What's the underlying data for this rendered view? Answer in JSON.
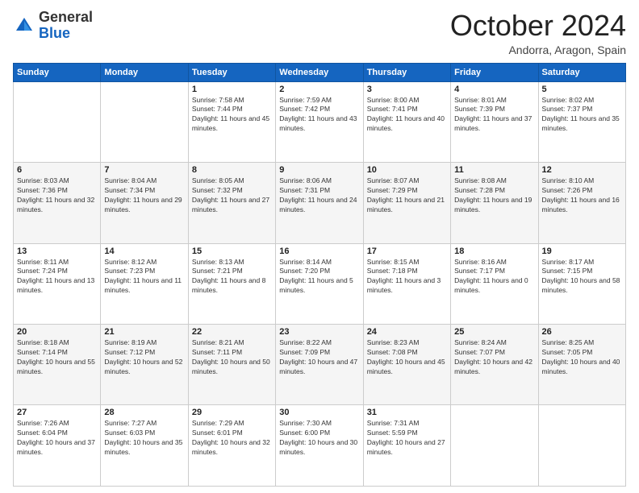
{
  "header": {
    "logo": {
      "general": "General",
      "blue": "Blue"
    },
    "title": "October 2024",
    "subtitle": "Andorra, Aragon, Spain"
  },
  "days_of_week": [
    "Sunday",
    "Monday",
    "Tuesday",
    "Wednesday",
    "Thursday",
    "Friday",
    "Saturday"
  ],
  "weeks": [
    [
      {
        "day": "",
        "info": ""
      },
      {
        "day": "",
        "info": ""
      },
      {
        "day": "1",
        "sunrise": "Sunrise: 7:58 AM",
        "sunset": "Sunset: 7:44 PM",
        "daylight": "Daylight: 11 hours and 45 minutes."
      },
      {
        "day": "2",
        "sunrise": "Sunrise: 7:59 AM",
        "sunset": "Sunset: 7:42 PM",
        "daylight": "Daylight: 11 hours and 43 minutes."
      },
      {
        "day": "3",
        "sunrise": "Sunrise: 8:00 AM",
        "sunset": "Sunset: 7:41 PM",
        "daylight": "Daylight: 11 hours and 40 minutes."
      },
      {
        "day": "4",
        "sunrise": "Sunrise: 8:01 AM",
        "sunset": "Sunset: 7:39 PM",
        "daylight": "Daylight: 11 hours and 37 minutes."
      },
      {
        "day": "5",
        "sunrise": "Sunrise: 8:02 AM",
        "sunset": "Sunset: 7:37 PM",
        "daylight": "Daylight: 11 hours and 35 minutes."
      }
    ],
    [
      {
        "day": "6",
        "sunrise": "Sunrise: 8:03 AM",
        "sunset": "Sunset: 7:36 PM",
        "daylight": "Daylight: 11 hours and 32 minutes."
      },
      {
        "day": "7",
        "sunrise": "Sunrise: 8:04 AM",
        "sunset": "Sunset: 7:34 PM",
        "daylight": "Daylight: 11 hours and 29 minutes."
      },
      {
        "day": "8",
        "sunrise": "Sunrise: 8:05 AM",
        "sunset": "Sunset: 7:32 PM",
        "daylight": "Daylight: 11 hours and 27 minutes."
      },
      {
        "day": "9",
        "sunrise": "Sunrise: 8:06 AM",
        "sunset": "Sunset: 7:31 PM",
        "daylight": "Daylight: 11 hours and 24 minutes."
      },
      {
        "day": "10",
        "sunrise": "Sunrise: 8:07 AM",
        "sunset": "Sunset: 7:29 PM",
        "daylight": "Daylight: 11 hours and 21 minutes."
      },
      {
        "day": "11",
        "sunrise": "Sunrise: 8:08 AM",
        "sunset": "Sunset: 7:28 PM",
        "daylight": "Daylight: 11 hours and 19 minutes."
      },
      {
        "day": "12",
        "sunrise": "Sunrise: 8:10 AM",
        "sunset": "Sunset: 7:26 PM",
        "daylight": "Daylight: 11 hours and 16 minutes."
      }
    ],
    [
      {
        "day": "13",
        "sunrise": "Sunrise: 8:11 AM",
        "sunset": "Sunset: 7:24 PM",
        "daylight": "Daylight: 11 hours and 13 minutes."
      },
      {
        "day": "14",
        "sunrise": "Sunrise: 8:12 AM",
        "sunset": "Sunset: 7:23 PM",
        "daylight": "Daylight: 11 hours and 11 minutes."
      },
      {
        "day": "15",
        "sunrise": "Sunrise: 8:13 AM",
        "sunset": "Sunset: 7:21 PM",
        "daylight": "Daylight: 11 hours and 8 minutes."
      },
      {
        "day": "16",
        "sunrise": "Sunrise: 8:14 AM",
        "sunset": "Sunset: 7:20 PM",
        "daylight": "Daylight: 11 hours and 5 minutes."
      },
      {
        "day": "17",
        "sunrise": "Sunrise: 8:15 AM",
        "sunset": "Sunset: 7:18 PM",
        "daylight": "Daylight: 11 hours and 3 minutes."
      },
      {
        "day": "18",
        "sunrise": "Sunrise: 8:16 AM",
        "sunset": "Sunset: 7:17 PM",
        "daylight": "Daylight: 11 hours and 0 minutes."
      },
      {
        "day": "19",
        "sunrise": "Sunrise: 8:17 AM",
        "sunset": "Sunset: 7:15 PM",
        "daylight": "Daylight: 10 hours and 58 minutes."
      }
    ],
    [
      {
        "day": "20",
        "sunrise": "Sunrise: 8:18 AM",
        "sunset": "Sunset: 7:14 PM",
        "daylight": "Daylight: 10 hours and 55 minutes."
      },
      {
        "day": "21",
        "sunrise": "Sunrise: 8:19 AM",
        "sunset": "Sunset: 7:12 PM",
        "daylight": "Daylight: 10 hours and 52 minutes."
      },
      {
        "day": "22",
        "sunrise": "Sunrise: 8:21 AM",
        "sunset": "Sunset: 7:11 PM",
        "daylight": "Daylight: 10 hours and 50 minutes."
      },
      {
        "day": "23",
        "sunrise": "Sunrise: 8:22 AM",
        "sunset": "Sunset: 7:09 PM",
        "daylight": "Daylight: 10 hours and 47 minutes."
      },
      {
        "day": "24",
        "sunrise": "Sunrise: 8:23 AM",
        "sunset": "Sunset: 7:08 PM",
        "daylight": "Daylight: 10 hours and 45 minutes."
      },
      {
        "day": "25",
        "sunrise": "Sunrise: 8:24 AM",
        "sunset": "Sunset: 7:07 PM",
        "daylight": "Daylight: 10 hours and 42 minutes."
      },
      {
        "day": "26",
        "sunrise": "Sunrise: 8:25 AM",
        "sunset": "Sunset: 7:05 PM",
        "daylight": "Daylight: 10 hours and 40 minutes."
      }
    ],
    [
      {
        "day": "27",
        "sunrise": "Sunrise: 7:26 AM",
        "sunset": "Sunset: 6:04 PM",
        "daylight": "Daylight: 10 hours and 37 minutes."
      },
      {
        "day": "28",
        "sunrise": "Sunrise: 7:27 AM",
        "sunset": "Sunset: 6:03 PM",
        "daylight": "Daylight: 10 hours and 35 minutes."
      },
      {
        "day": "29",
        "sunrise": "Sunrise: 7:29 AM",
        "sunset": "Sunset: 6:01 PM",
        "daylight": "Daylight: 10 hours and 32 minutes."
      },
      {
        "day": "30",
        "sunrise": "Sunrise: 7:30 AM",
        "sunset": "Sunset: 6:00 PM",
        "daylight": "Daylight: 10 hours and 30 minutes."
      },
      {
        "day": "31",
        "sunrise": "Sunrise: 7:31 AM",
        "sunset": "Sunset: 5:59 PM",
        "daylight": "Daylight: 10 hours and 27 minutes."
      },
      {
        "day": "",
        "info": ""
      },
      {
        "day": "",
        "info": ""
      }
    ]
  ]
}
